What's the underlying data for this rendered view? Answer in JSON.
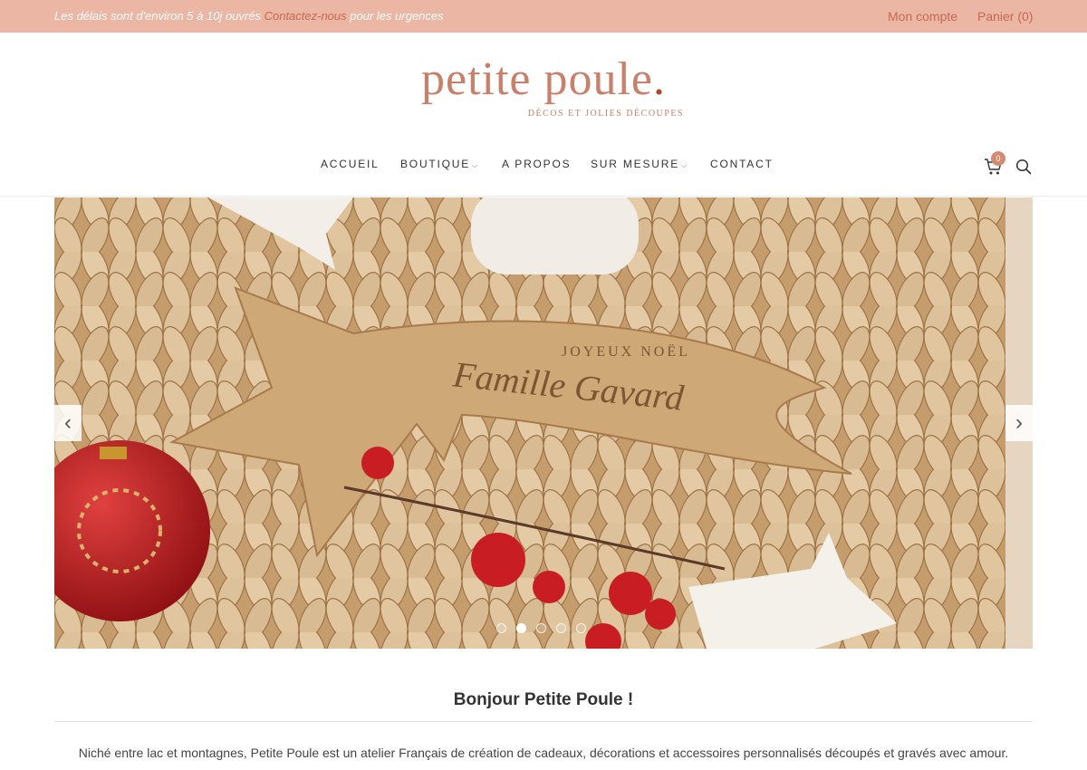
{
  "topbar": {
    "notice_before": "Les délais sont d'environ 5 à 10j ouvrés",
    "notice_link": "Contactez-nous",
    "notice_after": "pour les urgences",
    "account": "Mon compte",
    "cart": "Panier (0)",
    "bg_color": "#ebb6a4",
    "accent_color": "#c56a4f"
  },
  "logo": {
    "name": "petite poule",
    "dot": ".",
    "tagline": "DÉCOS ET JOLIES DÉCOUPES"
  },
  "nav": {
    "items": [
      {
        "label": "ACCUEIL",
        "dropdown": false
      },
      {
        "label": "BOUTIQUE",
        "dropdown": true
      },
      {
        "label": "A PROPOS",
        "dropdown": false
      },
      {
        "label": "SUR MESURE",
        "dropdown": true
      },
      {
        "label": "CONTACT",
        "dropdown": false
      }
    ],
    "cart_count": "0",
    "cart_icon": "cart-icon",
    "search_icon": "search-icon"
  },
  "slider": {
    "engraving_top": "JOYEUX NOËL",
    "engraving_main": "Famille Gavard",
    "prev": "‹",
    "next": "›",
    "slide_count": 5,
    "active_slide": 2
  },
  "welcome": {
    "title": "Bonjour Petite Poule !",
    "text": "Niché entre lac et montagnes, Petite Poule est un atelier Français de création de cadeaux, décorations et accessoires personnalisés découpés et gravés avec amour."
  }
}
